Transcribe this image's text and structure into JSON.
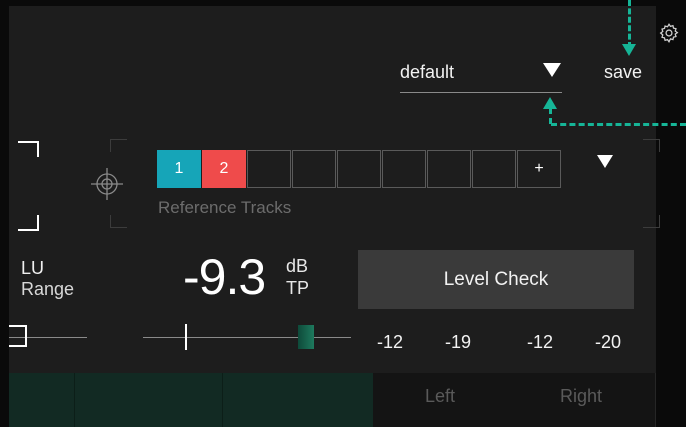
{
  "preset": {
    "name": "default",
    "save_label": "save"
  },
  "icons": {
    "settings": "gear-icon",
    "target": "crosshair-icon",
    "preset_dropdown": "triangle-down-icon"
  },
  "reference_tracks": {
    "label": "Reference Tracks",
    "slots": [
      "1",
      "2",
      "",
      "",
      "",
      "",
      "",
      "",
      "+"
    ],
    "colors": {
      "track1": "#16a5b8",
      "track2": "#ef4b4b"
    }
  },
  "loudness_range": {
    "unit": "LU",
    "label": "Range"
  },
  "true_peak": {
    "value": "-9.3",
    "unit_top": "dB",
    "unit_bottom": "TP"
  },
  "level_check": {
    "label": "Level Check"
  },
  "readouts": [
    "-12",
    "-19",
    "-12",
    "-20"
  ],
  "channels": {
    "left": "Left",
    "right": "Right"
  },
  "accent_color": "#16b597"
}
